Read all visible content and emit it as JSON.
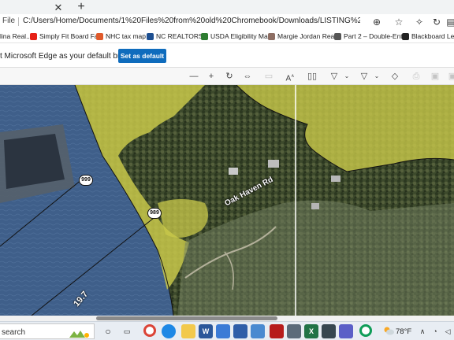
{
  "browser": {
    "file_label": "File",
    "url": "C:/Users/Home/Documents/1%20Files%20from%20old%20Chromebook/Downloads/LISTING%20CLIENTS%202018---/2022...",
    "new_tab_symbol": "+",
    "close_tab_symbol": "✕"
  },
  "bookmarks": [
    {
      "label": "lina Real...",
      "color": "#3a6fb5"
    },
    {
      "label": "Simply Fit Board Fa...",
      "color": "#e62117"
    },
    {
      "label": "NHC tax map",
      "color": "#e05a2b"
    },
    {
      "label": "NC REALTORS®",
      "color": "#1d4f91"
    },
    {
      "label": "USDA Eligibility Map",
      "color": "#2e7d32"
    },
    {
      "label": "Margie Jordan Real...",
      "color": "#8d6e63"
    },
    {
      "label": "Part 2 – Double-Ent...",
      "color": "#333333"
    },
    {
      "label": "Blackboard Learn",
      "color": "#222222"
    }
  ],
  "infobar": {
    "message": "t Microsoft Edge as your default browser?",
    "button": "Set as default"
  },
  "pdf_toolbar": {
    "icons": [
      "zoom-out-icon",
      "zoom-in-icon",
      "rotate-icon",
      "fit-page-icon",
      "page-view-icon",
      "read-aloud-icon",
      "two-page-icon",
      "draw-icon",
      "highlight-icon",
      "eraser-icon",
      "print-icon",
      "save-icon",
      "save-as-icon"
    ],
    "read_aloud_label": "A",
    "read_aloud_sup": "∧"
  },
  "map": {
    "road_label": "Oak Haven Rd",
    "route_shields": [
      "999",
      "989"
    ],
    "parcel_number": "19.7"
  },
  "scrollbar": {
    "horizontal_position": 0.21
  },
  "taskbar": {
    "search_label": "search",
    "weather_temp": "78°F",
    "apps": [
      "cortana",
      "task-view",
      "chrome",
      "edge",
      "file-explorer",
      "word",
      "calculator",
      "calendar",
      "snipping",
      "camera",
      "excel",
      "notepad",
      "teams",
      "chrome-2"
    ]
  },
  "colors": {
    "edge_button": "#0f6cbd",
    "flood_zone": "#c8c84a",
    "water": "#3f5f8a"
  }
}
